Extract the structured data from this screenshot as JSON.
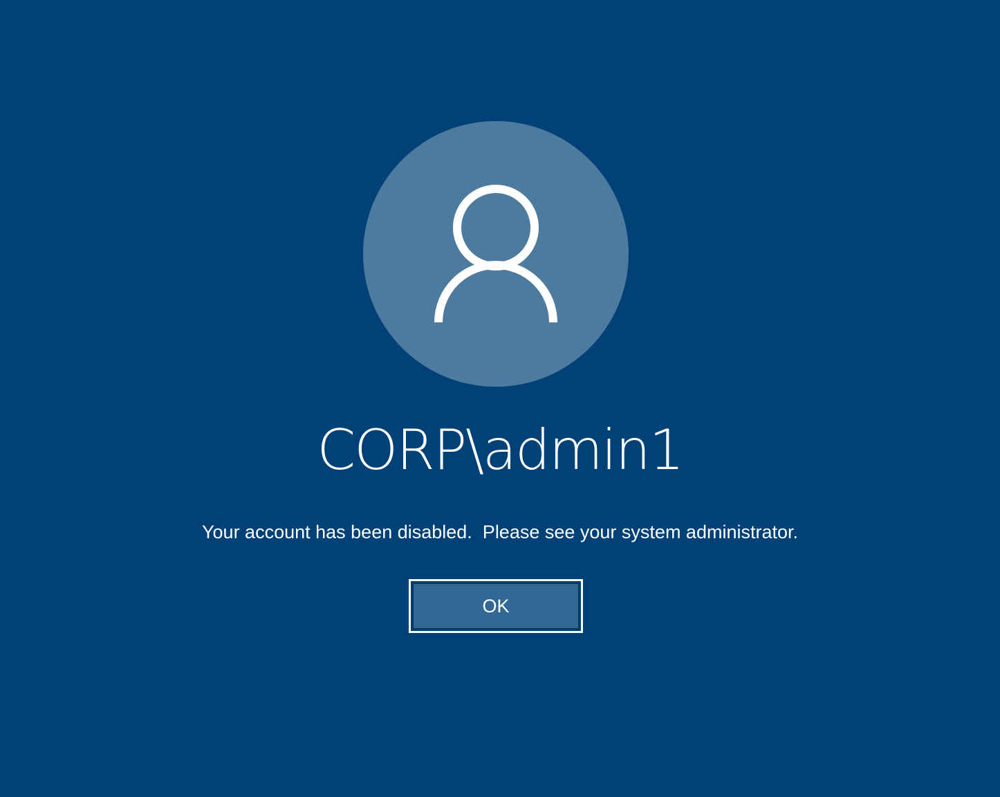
{
  "login": {
    "avatar_icon": "user-silhouette-icon",
    "username": "CORP\\admin1",
    "message": "Your account has been disabled.  Please see your system administrator.",
    "ok_label": "OK"
  },
  "colors": {
    "background": "#014177",
    "avatar_circle": "#4d7a9f",
    "button_fill": "#326894",
    "foreground": "#ffffff"
  }
}
